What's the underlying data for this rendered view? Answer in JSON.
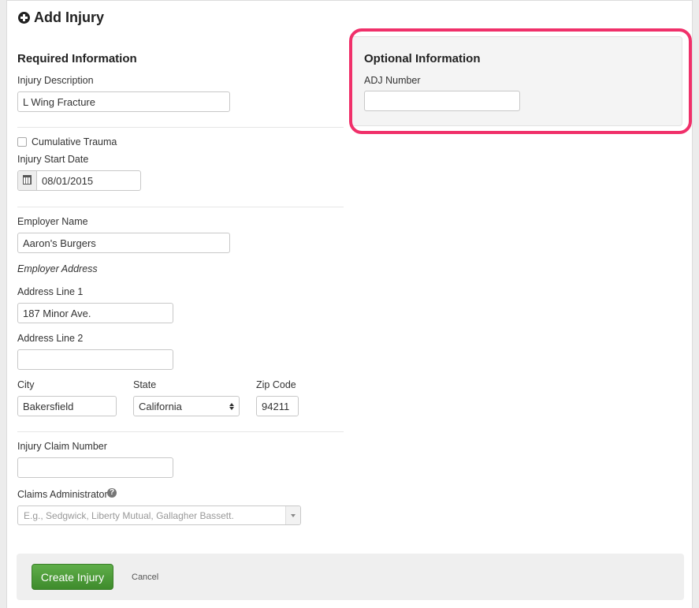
{
  "page": {
    "title": "Add Injury"
  },
  "required": {
    "heading": "Required Information",
    "injury_description": {
      "label": "Injury Description",
      "value": "L Wing Fracture"
    },
    "cumulative_trauma": {
      "label": "Cumulative Trauma",
      "checked": false
    },
    "injury_start_date": {
      "label": "Injury Start Date",
      "value": "08/01/2015"
    },
    "employer_name": {
      "label": "Employer Name",
      "value": "Aaron's Burgers"
    },
    "employer_address_heading": "Employer Address",
    "address_line_1": {
      "label": "Address Line 1",
      "value": "187 Minor Ave."
    },
    "address_line_2": {
      "label": "Address Line 2",
      "value": ""
    },
    "city": {
      "label": "City",
      "value": "Bakersfield"
    },
    "state": {
      "label": "State",
      "value": "California"
    },
    "zip": {
      "label": "Zip Code",
      "value": "94211"
    },
    "injury_claim_number": {
      "label": "Injury Claim Number",
      "value": ""
    },
    "claims_administrator": {
      "label": "Claims Administrator",
      "help": "?",
      "placeholder": "E.g., Sedgwick, Liberty Mutual, Gallagher Bassett."
    }
  },
  "optional": {
    "heading": "Optional Information",
    "adj_number": {
      "label": "ADJ Number",
      "value": ""
    }
  },
  "actions": {
    "create_label": "Create Injury",
    "cancel_label": "Cancel"
  },
  "colors": {
    "highlight": "#f0306a",
    "primary_button": "#4a9a35"
  }
}
